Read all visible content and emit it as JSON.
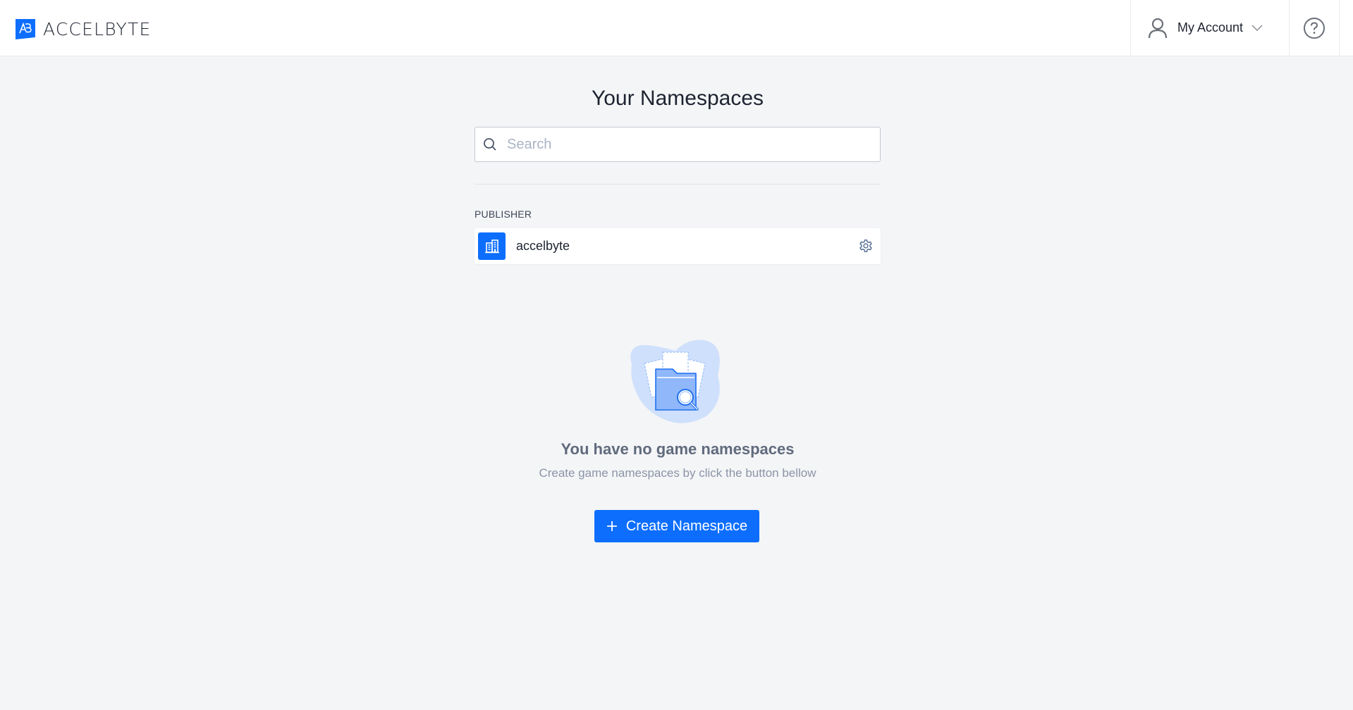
{
  "header": {
    "brand": "ACCELBYTE",
    "brand_mark": "AB",
    "account_label": "My Account",
    "account_icon": "user-icon",
    "chevron_icon": "chevron-down-icon",
    "help_icon": "help-circle-icon"
  },
  "main": {
    "title": "Your Namespaces",
    "search": {
      "placeholder": "Search",
      "value": "",
      "icon": "search-icon"
    },
    "publisher_section": {
      "label": "PUBLISHER",
      "items": [
        {
          "name": "accelbyte",
          "icon": "building-icon",
          "action_icon": "gear-icon"
        }
      ]
    },
    "empty_state": {
      "illustration": "folder-search-illustration",
      "title": "You have no game namespaces",
      "subtitle": "Create game namespaces by click the button bellow"
    },
    "create_button": {
      "label": "Create Namespace",
      "icon": "plus-icon"
    }
  },
  "colors": {
    "primary": "#0d6efd",
    "background": "#f4f5f7",
    "header_bg": "#ffffff",
    "text_dark": "#1d2330",
    "text_muted": "#8b94a6"
  }
}
